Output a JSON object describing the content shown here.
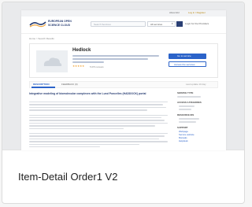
{
  "topbar": {
    "link1": "About EU",
    "link2": "Log in / Register"
  },
  "header": {
    "brand_line1": "EUROPEAN OPEN",
    "brand_line2": "SCIENCE CLOUD",
    "search_placeholder": "Search Services",
    "select_value": "All services",
    "login_label": "Login for the Providers"
  },
  "breadcrumb": "Home > Search Results",
  "service": {
    "title": "Hedlock",
    "request_button": "Go to service",
    "secondary_button": "Access the services",
    "rating_text": "5.0/5 reviews"
  },
  "tabs": [
    {
      "label": "DESCRIPTION"
    },
    {
      "label": "FEEDBACK (0)"
    }
  ],
  "tabs_right": "Last update 10 day",
  "content": {
    "heading": "Integrative modeling of biomolecular complexes with the Lund Poncelles (HADDOCK) portal"
  },
  "sidebar": {
    "title1": "SERVICE TYPE",
    "title2": "ACCESS CATEGORIES",
    "title3": "RESOURCE IDS",
    "title4": "SUPPORT",
    "links": [
      "Webpage",
      "Service website",
      "Manuals",
      "Helpdesk"
    ]
  },
  "caption": "Item-Detail Order1 V2",
  "colors": {
    "accent": "#2b63c9",
    "navy": "#2a3f74",
    "orange": "#f0a43a"
  }
}
